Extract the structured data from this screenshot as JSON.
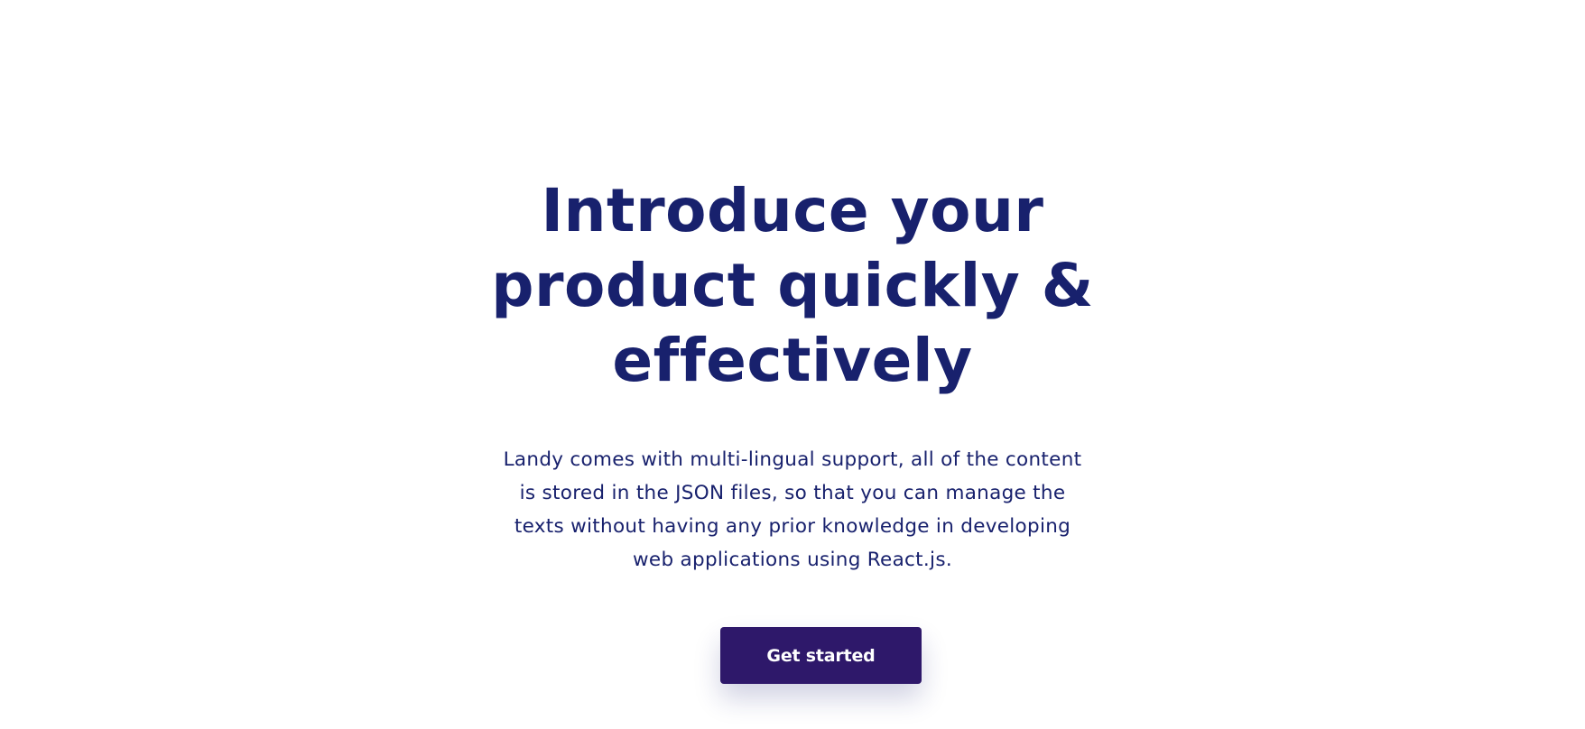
{
  "hero": {
    "title": "Introduce your product quickly & effectively",
    "subtitle": "Landy comes with multi-lingual support, all of the content is stored in the JSON files, so that you can manage the texts without having any prior knowledge in developing web applications using React.js.",
    "cta_label": "Get started"
  },
  "colors": {
    "heading": "#18216d",
    "body_text": "#18216d",
    "button_background": "#2e186a",
    "button_text": "#ffffff",
    "page_background": "#ffffff"
  }
}
